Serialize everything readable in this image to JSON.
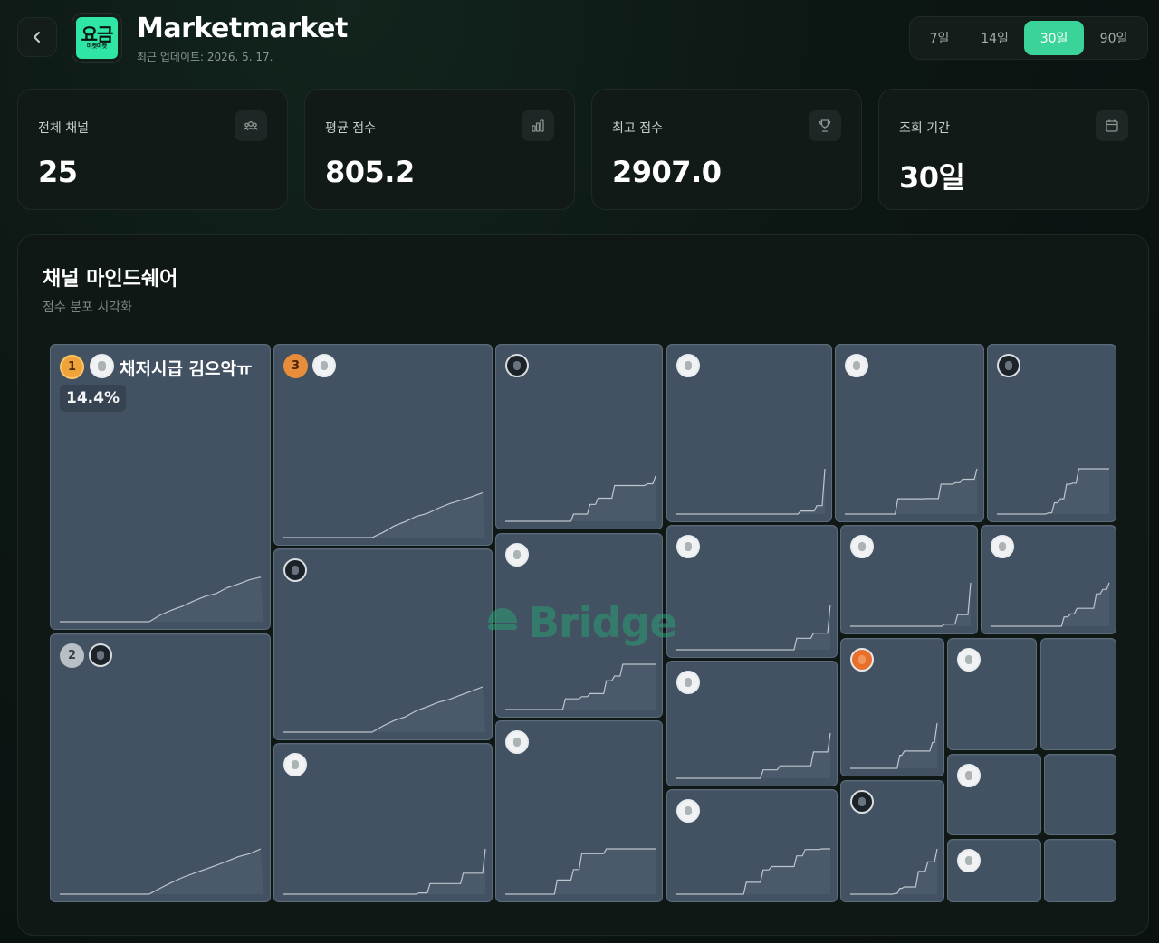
{
  "header": {
    "title": "Marketmarket",
    "updated": "최근 업데이트: 2026. 5. 17.",
    "logo_mark": "요금",
    "logo_sub": "마켓마켓"
  },
  "periods": [
    {
      "label": "7일",
      "active": false
    },
    {
      "label": "14일",
      "active": false
    },
    {
      "label": "30일",
      "active": true
    },
    {
      "label": "90일",
      "active": false
    }
  ],
  "stats": [
    {
      "label": "전체 채널",
      "value": "25",
      "icon": "users-icon"
    },
    {
      "label": "평균 점수",
      "value": "805.2",
      "icon": "bar-chart-icon"
    },
    {
      "label": "최고 점수",
      "value": "2907.0",
      "icon": "trophy-icon"
    },
    {
      "label": "조회 기간",
      "value": "30일",
      "icon": "calendar-icon"
    }
  ],
  "panel": {
    "title": "채널 마인드쉐어",
    "subtitle": "점수 분포 시각화"
  },
  "top_channel": {
    "rank": "1",
    "name": "채저시급 김으악ㅠ",
    "share": "14.4%"
  },
  "ranks": {
    "second": "2",
    "third": "3"
  },
  "watermark": "Bridge",
  "colors": {
    "accent": "#3ad49a",
    "tile": "#425262",
    "tile_border": "#5c6b79",
    "background": "#0c1613",
    "gold": "#f0a33a",
    "silver": "#b8c0c6",
    "bronze": "#e88d3b"
  }
}
